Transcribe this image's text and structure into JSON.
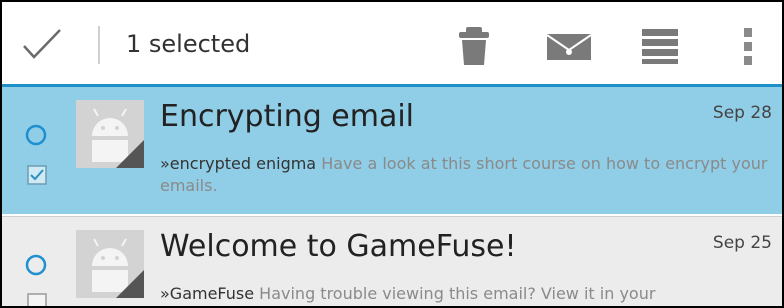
{
  "action_bar": {
    "selected_count": "1 selected",
    "icons": [
      "checkmark-icon",
      "trash-icon",
      "label-icon",
      "move-to-folder-icon",
      "overflow-menu-icon"
    ],
    "accent_color": "#1f8fc8"
  },
  "messages": [
    {
      "subject": "Encrypting email",
      "date": "Sep 28",
      "sender": "»encrypted enigma",
      "snippet": "Have a look at this short course on how to encrypt your emails.",
      "selected": true,
      "background": "#90cde6"
    },
    {
      "subject": "Welcome to GameFuse!",
      "date": "Sep 25",
      "sender": "»GameFuse",
      "snippet": "Having trouble viewing this email? View it in your",
      "selected": false,
      "background": "#ececec"
    }
  ]
}
